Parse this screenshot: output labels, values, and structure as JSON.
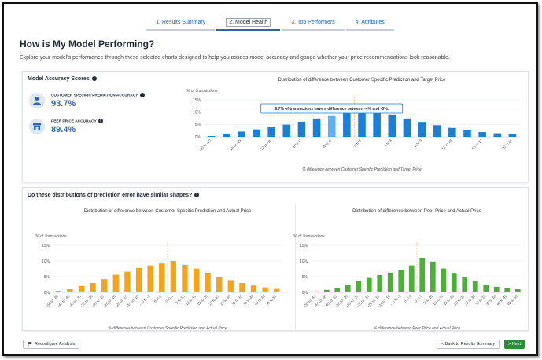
{
  "tabs": [
    {
      "label": "1. Results Summary"
    },
    {
      "label": "2. Model Health"
    },
    {
      "label": "3. Top Performers"
    },
    {
      "label": "4. Attributes"
    }
  ],
  "page": {
    "title": "How is My Model Performing?",
    "subtitle": "Explore your model's performance through these selected charts designed to help you assess model accuracy and gauge whether your price recommendations look reasonable."
  },
  "accuracy": {
    "title": "Model Accuracy Scores",
    "customer_label": "CUSTOMER SPECIFIC PREDICTION ACCURACY",
    "customer_value": "93.7%",
    "peer_label": "PEER PRICE ACCURACY",
    "peer_value": "89.4%"
  },
  "second_section": {
    "question": "Do these distributions of prediction error have similar shapes?"
  },
  "buttons": {
    "reconfigure": "Reconfigure Analysis",
    "back": "< Back to Results Summary",
    "next": "> Next"
  },
  "colors": {
    "blue": "#1c7fd6",
    "orange": "#f5a31a",
    "green": "#4caf3a",
    "accent": "#2c63b5"
  },
  "chart_data": [
    {
      "type": "bar",
      "title": "Distribution of difference between Customer Specific Prediction and Target Price",
      "ylabel": "% of Transactions",
      "xlabel": "% difference between Customer Specific Prediction and Target Price",
      "ylim": [
        0,
        15
      ],
      "yticks": [
        "0%",
        "5%",
        "10%",
        "15%"
      ],
      "categories": [
        "-20 to -19",
        "-18 to -17",
        "-16 to -15",
        "-14 to -13",
        "-12 to -11",
        "-10 to -9",
        "-8 to -7",
        "-6 to -5",
        "-4 to -3",
        "-2 to -1",
        "0 to 1",
        "2 to 3",
        "4 to 5",
        "6 to 7",
        "8 to 9",
        "10 to 11",
        "12 to 13",
        "14 to 15",
        "16 to 17",
        "18 to 19",
        "20 to 21"
      ],
      "xticklabels": [
        "-20 to -19",
        "-16 to -15",
        "-12 to -11",
        "-8 to -7",
        "-4 to -3",
        "0 to 1",
        "4 to 5",
        "8 to 9",
        "12 to 13",
        "16 to 17",
        "20 to 21"
      ],
      "values": [
        0.3,
        1.2,
        2.1,
        3.0,
        3.8,
        4.9,
        6.1,
        7.4,
        8.7,
        9.8,
        10.3,
        10.1,
        9.0,
        7.4,
        6.0,
        4.7,
        3.6,
        2.7,
        1.9,
        1.4,
        1.2
      ],
      "highlight_index": 8,
      "reference_line": 0,
      "tooltip": "6.7% of transactions have a difference between -4% and -5%.",
      "color": "#1c7fd6"
    },
    {
      "type": "bar",
      "title": "Distribution of difference between Customer Specific Prediction and Actual Price",
      "ylabel": "% of Transactions",
      "xlabel": "% difference between Customer Specific Prediction and Actual Price",
      "ylim": [
        0,
        15
      ],
      "yticks": [
        "0%",
        "5%",
        "10%",
        "15%"
      ],
      "categories": [
        "-50 to -45",
        "-45 to -40",
        "-40 to -35",
        "-35 to -30",
        "-30 to -25",
        "-25 to -20",
        "-20 to -15",
        "-15 to -10",
        "-10 to -5",
        "-5 to 0",
        "0 to 5",
        "5 to 10",
        "10 to 15",
        "15 to 20",
        "20 to 25",
        "25 to 30",
        "30 to 35",
        "35 to 40",
        "40 to 45",
        "45 to 50"
      ],
      "xticklabels": [
        "-50 to -45",
        "-45 to -40",
        "-40 to -35",
        "-35 to -30",
        "-30 to -25",
        "-25 to -20",
        "-20 to -15",
        "-15 to -10",
        "-10 to -5",
        "-5 to 0",
        "0 to 5",
        "5 to 10",
        "10 to 15",
        "15 to 20",
        "20 to 25",
        "25 to 30",
        "30 to 35",
        "35 to 40",
        "40 to 45",
        "45 to 50"
      ],
      "values": [
        0.5,
        1.0,
        2.0,
        3.0,
        4.2,
        5.6,
        6.6,
        7.8,
        8.6,
        9.2,
        10.0,
        8.8,
        7.6,
        6.3,
        5.0,
        3.9,
        3.0,
        2.2,
        1.6,
        1.1
      ],
      "reference_line": 0,
      "color": "#f5a31a"
    },
    {
      "type": "bar",
      "title": "Distribution of difference between Peer Price and Actual Price",
      "ylabel": "% of Transactions",
      "xlabel": "% difference between Peer Price and Actual Price",
      "ylim": [
        0,
        15
      ],
      "yticks": [
        "0%",
        "5%",
        "10%",
        "15%"
      ],
      "categories": [
        "-50 to -45",
        "-45 to -40",
        "-40 to -35",
        "-35 to -30",
        "-30 to -25",
        "-25 to -20",
        "-20 to -15",
        "-15 to -10",
        "-10 to -5",
        "-5 to 0",
        "0 to 5",
        "5 to 10",
        "10 to 15",
        "15 to 20",
        "20 to 25",
        "25 to 30",
        "30 to 35",
        "35 to 40",
        "40 to 45",
        "45 to 50"
      ],
      "xticklabels": [
        "-50 to -45",
        "-45 to -40",
        "-40 to -35",
        "-35 to -30",
        "-30 to -25",
        "-25 to -20",
        "-20 to -15",
        "-15 to -10",
        "-10 to -5",
        "-5 to 0",
        "0 to 5",
        "5 to 10",
        "10 to 15",
        "15 to 20",
        "20 to 25",
        "25 to 30",
        "30 to 35",
        "35 to 40",
        "40 to 45",
        "45 to 50"
      ],
      "values": [
        0.3,
        0.8,
        1.4,
        2.4,
        3.6,
        4.6,
        5.5,
        6.3,
        7.0,
        8.6,
        11.0,
        9.8,
        7.6,
        6.2,
        4.8,
        3.6,
        2.4,
        1.8,
        1.4,
        1.0
      ],
      "reference_line": 0,
      "color": "#4caf3a"
    }
  ]
}
